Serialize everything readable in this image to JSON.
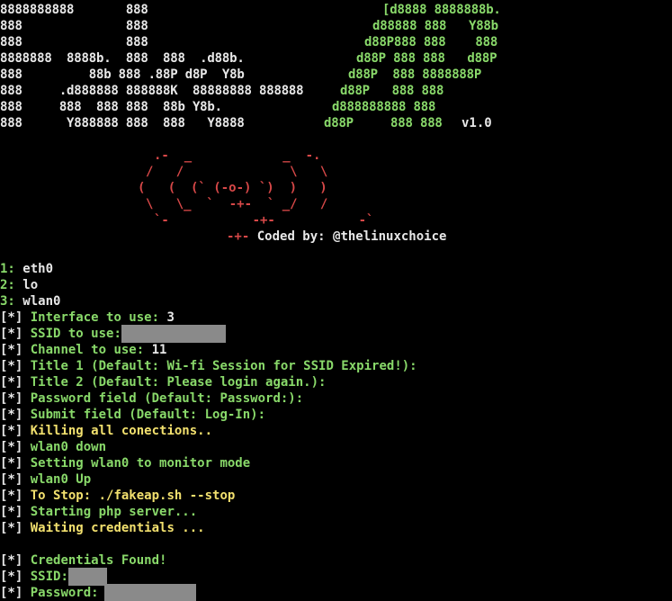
{
  "colors": {
    "background": "#000000",
    "white": "#e8e8e8",
    "green": "#89d96a",
    "yellow": "#f2e06e",
    "red": "#d74848",
    "redaction": "#8a8a8a"
  },
  "banner": {
    "left_lines": [
      "8888888888       888",
      "888              888",
      "888              888",
      "8888888  8888b.  888  888  .d88b.",
      "888         88b 888 .88P d8P  Y8b",
      "888     .d888888 888888K  88888888 888888",
      "888     888  888 888  88b Y8b.",
      "888      Y888888 888  888   Y8888"
    ],
    "right_lines": [
      "[d8888 8888888b.",
      "d88888 888   Y88b",
      "d88P888 888    888",
      "d88P 888 888   d88P",
      "d88P  888 8888888P",
      "d88P   888 888",
      "d888888888 888",
      "d88P     888 888"
    ],
    "version": "v1.0"
  },
  "logo": {
    "lines": [
      ".-  _            _  -.",
      "/   /              \\   \\",
      "(   (  (` (-o-) `)  )   )",
      "\\   \\_  `  -+-  ` _/   /",
      "`-           -+-           -`",
      "-+-"
    ],
    "credit": "Coded by: @thelinuxchoice"
  },
  "interfaces": [
    {
      "num": "1:",
      "name": "eth0"
    },
    {
      "num": "2:",
      "name": "lo"
    },
    {
      "num": "3:",
      "name": "wlan0"
    }
  ],
  "prompt_tag": "[*]",
  "prompts": {
    "interface_label": "Interface to use:",
    "interface_value": "3",
    "ssid_label": "SSID to use:",
    "channel_label": "Channel to use:",
    "channel_value": "11",
    "title1": "Title 1 (Default: Wi-fi Session for SSID Expired!):",
    "title2": "Title 2 (Default: Please login again.):",
    "password_field": "Password field (Default: Password:):",
    "submit_field": "Submit field (Default: Log-In):"
  },
  "status": {
    "killing": "Killing all conections..",
    "down": "wlan0 down",
    "monitor": "Setting wlan0 to monitor mode",
    "up": "wlan0 Up",
    "to_stop": "To Stop: ./fakeap.sh --stop",
    "php": "Starting php server...",
    "waiting": "Waiting credentials ..."
  },
  "credentials": {
    "found": "Credentials Found!",
    "ssid_label": "SSID:",
    "password_label": "Password:"
  }
}
